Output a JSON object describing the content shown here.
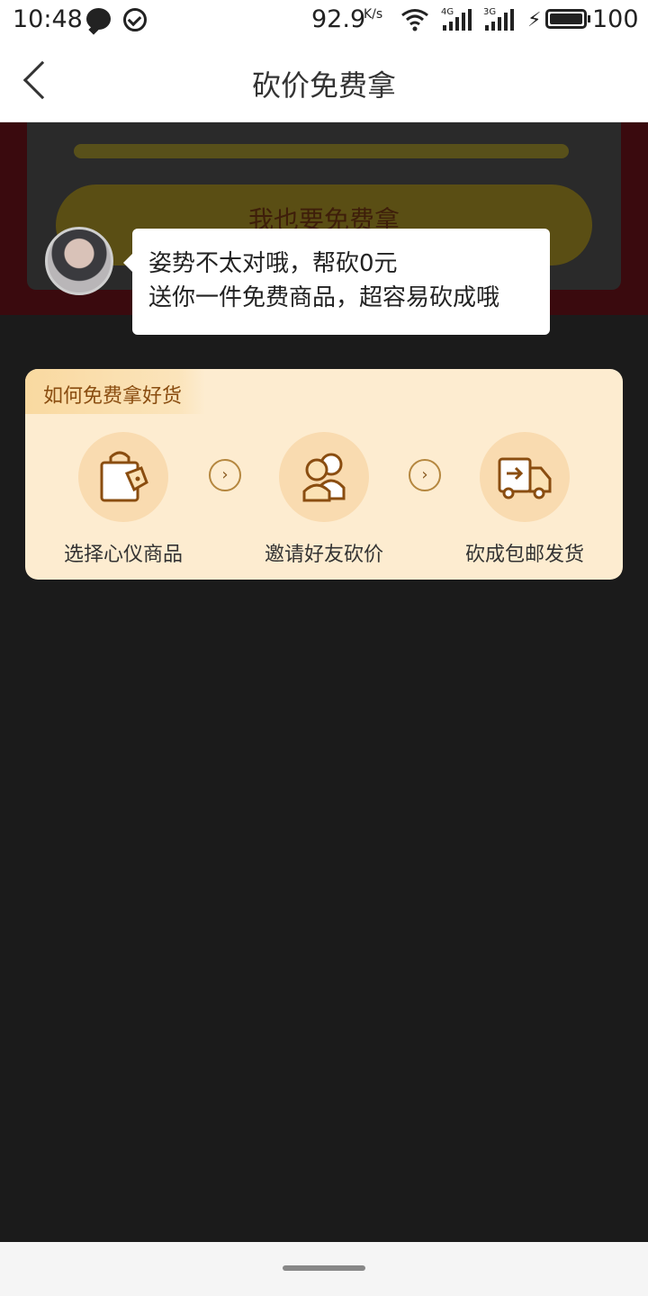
{
  "status_bar": {
    "time": "10:48",
    "net_speed": "92.9",
    "net_unit": "K/s",
    "sim1_label": "4G",
    "sim2_label": "3G",
    "battery": "100",
    "icons": [
      "chat-icon",
      "check-circle-icon",
      "wifi-icon",
      "signal-icon",
      "charging-icon",
      "battery-icon"
    ]
  },
  "nav": {
    "title": "砍价免费拿",
    "back_icon": "chevron-left-icon"
  },
  "background": {
    "button_label": "我也要免费拿"
  },
  "bubble": {
    "line1": "姿势不太对哦，帮砍0元",
    "line2": "送你一件免费商品，超容易砍成哦"
  },
  "howto": {
    "title": "如何免费拿好货",
    "steps": [
      {
        "label": "选择心仪商品",
        "icon": "shopping-bag-icon"
      },
      {
        "label": "邀请好友砍价",
        "icon": "friends-icon"
      },
      {
        "label": "砍成包邮发货",
        "icon": "delivery-truck-icon"
      }
    ],
    "arrow_glyph": "›"
  },
  "colors": {
    "card_bg": "#fdecd0",
    "icon_circle": "#f9dbb0",
    "accent_brown": "#8a4d10"
  }
}
